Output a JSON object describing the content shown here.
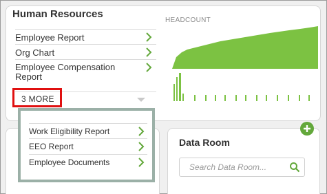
{
  "human_resources": {
    "title": "Human Resources",
    "items": [
      {
        "label": "Employee Report"
      },
      {
        "label": "Org Chart"
      },
      {
        "label": "Employee Compensation Report"
      }
    ],
    "more_label": "3 MORE"
  },
  "chart": {
    "label": "HEADCOUNT",
    "color": "#7cc242"
  },
  "popout": {
    "items": [
      {
        "label": "Work Eligibility Report"
      },
      {
        "label": "EEO Report"
      },
      {
        "label": "Employee Documents"
      }
    ]
  },
  "data_room": {
    "title": "Data Room",
    "search_placeholder": "Search Data Room...",
    "add_icon": "plus-icon"
  },
  "colors": {
    "accent_green": "#63a83b",
    "highlight_red": "#e01010",
    "popout_border": "#9bb0a7"
  }
}
